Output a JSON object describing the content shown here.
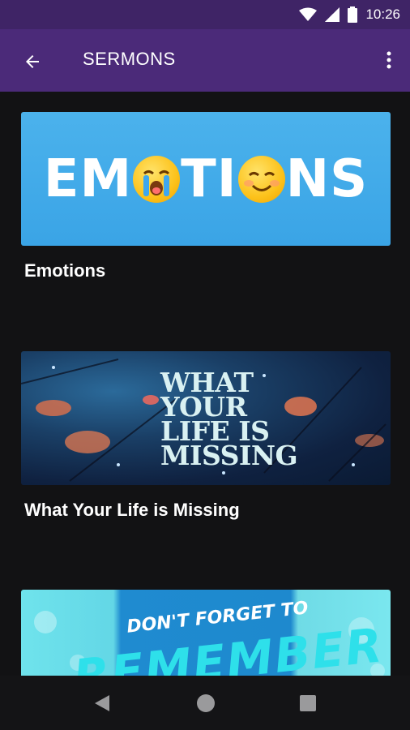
{
  "status_bar": {
    "time": "10:26"
  },
  "app_bar": {
    "title": "SERMONS"
  },
  "sermons": [
    {
      "title": "Emotions",
      "banner_text": [
        "EM",
        "TI",
        "NS"
      ]
    },
    {
      "title": "What Your Life is Missing",
      "banner_lines": [
        "WHAT",
        "YOUR",
        "LIFE IS",
        "MISSING"
      ]
    },
    {
      "banner_line1": "DON'T FORGET TO",
      "banner_line2": "REMEMBER"
    }
  ],
  "colors": {
    "status_bar": "#3f2466",
    "app_bar": "#4b2a79",
    "background": "#121214"
  },
  "icons": {
    "back": "arrow-back-icon",
    "more": "more-vert-icon",
    "wifi": "wifi-icon",
    "signal": "signal-icon",
    "battery": "battery-icon",
    "nav_back": "triangle-back-icon",
    "nav_home": "circle-home-icon",
    "nav_recents": "square-recents-icon"
  }
}
